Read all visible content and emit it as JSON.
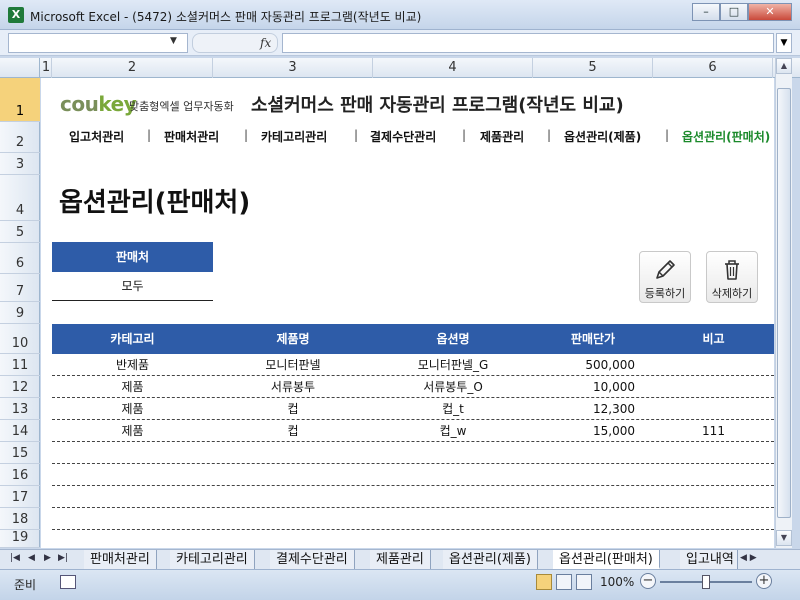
{
  "window": {
    "title": "Microsoft Excel - (5472) 소셜커머스 판매 자동관리 프로그램(작년도 비교)",
    "app_icon": "X",
    "minimize": "–",
    "maximize": "□",
    "close": "✕"
  },
  "formula_bar": {
    "fx_label": "fx",
    "name_box": "",
    "formula": ""
  },
  "columns": [
    "1",
    "2",
    "3",
    "4",
    "5",
    "6"
  ],
  "rows": [
    "1",
    "2",
    "3",
    "4",
    "5",
    "6",
    "7",
    "9",
    "10",
    "11",
    "12",
    "13",
    "14",
    "15",
    "16",
    "17",
    "18",
    "19"
  ],
  "brand": {
    "logo_pre": "cou",
    "logo_post": "key",
    "tagline": "맞춤형엑셀 업무자동화",
    "program_title": "소셜커머스 판매 자동관리 프로그램(작년도 비교)"
  },
  "menu": {
    "items": [
      "입고처관리",
      "판매처관리",
      "카테고리관리",
      "결제수단관리",
      "제품관리",
      "옵션관리(제품)",
      "옵션관리(판매처)"
    ],
    "separator": "|"
  },
  "page_title": "옵션관리(판매처)",
  "filter": {
    "header": "판매처",
    "value": "모두"
  },
  "actions": {
    "register": "등록하기",
    "delete": "삭제하기"
  },
  "table": {
    "headers": [
      "카테고리",
      "제품명",
      "옵션명",
      "판매단가",
      "비고"
    ],
    "rows": [
      [
        "반제품",
        "모니터판넬",
        "모니터판넬_G",
        "500,000",
        ""
      ],
      [
        "제품",
        "서류봉투",
        "서류봉투_O",
        "10,000",
        ""
      ],
      [
        "제품",
        "컵",
        "컵_t",
        "12,300",
        ""
      ],
      [
        "제품",
        "컵",
        "컵_w",
        "15,000",
        "111"
      ],
      [
        "",
        "",
        "",
        "",
        ""
      ],
      [
        "",
        "",
        "",
        "",
        ""
      ],
      [
        "",
        "",
        "",
        "",
        ""
      ],
      [
        "",
        "",
        "",
        "",
        ""
      ],
      [
        "",
        "",
        "",
        "",
        ""
      ]
    ]
  },
  "sheet_tabs": [
    "판매처관리",
    "카테고리관리",
    "결제수단관리",
    "제품관리",
    "옵션관리(제품)",
    "옵션관리(판매처)",
    "입고내역"
  ],
  "active_tab_index": 5,
  "status": {
    "ready": "준비",
    "zoom": "100%"
  },
  "colors": {
    "header_blue": "#2e5ca8",
    "active_menu": "#1b8a2b",
    "brand_green": "#6f8d3a"
  }
}
